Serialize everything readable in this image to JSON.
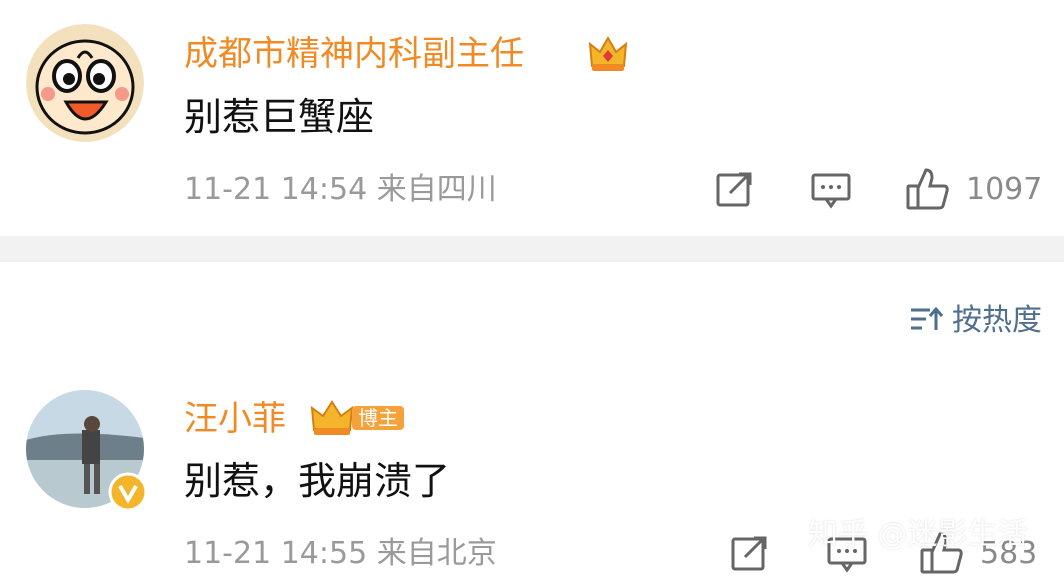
{
  "comment1": {
    "author": "成都市精神内科副主任",
    "text": "别惹巨蟹座",
    "meta": "11-21 14:54  来自四川",
    "like_count": "1097",
    "avatar_icon": "cartoon-face-avatar",
    "author_badge_icon": "crown-icon"
  },
  "sort": {
    "label": "按热度",
    "icon": "sort-icon"
  },
  "comment2": {
    "author": "汪小菲",
    "badge": "博主",
    "text": "别惹，我崩溃了",
    "meta": "11-21 14:55  来自北京",
    "like_count": "583",
    "avatar_icon": "beach-photo-avatar",
    "verified_icon": "verified-v-icon"
  },
  "watermark": {
    "text": "知乎 @迷影生活"
  },
  "colors": {
    "username": "#f08a24",
    "meta": "#9a9a9a",
    "divider": "#f2f2f2",
    "sort": "#4f6f8f"
  }
}
